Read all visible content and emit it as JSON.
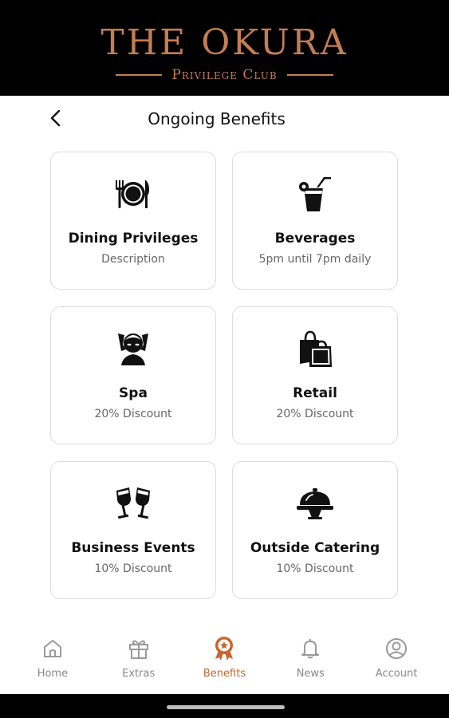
{
  "brand": {
    "title": "THE OKURA",
    "subtitle": "Privilege Club",
    "color": "#c47e52"
  },
  "header": {
    "title": "Ongoing Benefits",
    "back_icon": "chevron-left-icon"
  },
  "benefits": [
    {
      "title": "Dining Privileges",
      "description": "Description",
      "icon": "plate-cutlery-icon"
    },
    {
      "title": "Beverages",
      "description": "5pm until 7pm daily",
      "icon": "cocktail-glass-icon"
    },
    {
      "title": "Spa",
      "description": "20% Discount",
      "icon": "spa-face-icon"
    },
    {
      "title": "Retail",
      "description": "20% Discount",
      "icon": "shopping-bags-icon"
    },
    {
      "title": "Business Events",
      "description": "10% Discount",
      "icon": "toast-glasses-icon"
    },
    {
      "title": "Outside Catering",
      "description": "10% Discount",
      "icon": "cloche-icon"
    }
  ],
  "nav": {
    "active_color": "#c8662c",
    "items": [
      {
        "label": "Home",
        "icon": "home-icon"
      },
      {
        "label": "Extras",
        "icon": "gift-icon"
      },
      {
        "label": "Benefits",
        "icon": "award-badge-icon",
        "active": true
      },
      {
        "label": "News",
        "icon": "bell-icon"
      },
      {
        "label": "Account",
        "icon": "account-circle-icon"
      }
    ]
  }
}
